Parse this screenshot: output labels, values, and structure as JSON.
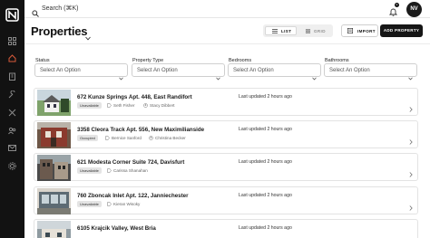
{
  "search": {
    "placeholder": "Search (⌘K)"
  },
  "topbar": {
    "notification_count": "0",
    "avatar_initials": "NV"
  },
  "header": {
    "title": "Properties",
    "view_toggle": {
      "list_label": "LIST",
      "grid_label": "GRID",
      "selected": "LIST"
    },
    "import_label": "IMPORT",
    "add_label": "ADD PROPERTY"
  },
  "filters": [
    {
      "label": "Status",
      "placeholder": "Select An Option"
    },
    {
      "label": "Property Type",
      "placeholder": "Select An Option"
    },
    {
      "label": "Bedrooms",
      "placeholder": "Select An Option"
    },
    {
      "label": "Bathrooms",
      "placeholder": "Select An Option"
    }
  ],
  "properties": [
    {
      "address": "672 Kunze Springs Apt. 448, East Randifort",
      "status": "Unavailable",
      "agent": "Seth Fisher",
      "owner": "Stacy Dibbert",
      "updated": "Last updated 2 hours ago"
    },
    {
      "address": "3358 Cleora Track Apt. 556, New Maximilianside",
      "status": "Occupied",
      "agent": "Bernice Sanford",
      "owner": "Christina Becker",
      "updated": "Last updated 2 hours ago"
    },
    {
      "address": "621 Modesta Corner Suite 724, Davisfurt",
      "status": "Unavailable",
      "agent": "Carissa Shanahan",
      "owner": "",
      "updated": "Last updated 2 hours ago"
    },
    {
      "address": "760 Zboncak Inlet Apt. 122, Janniechester",
      "status": "Unavailable",
      "agent": "Kieran Wisoky",
      "owner": "",
      "updated": "Last updated 2 hours ago"
    },
    {
      "address": "6105 Krajcik Valley, West Bria",
      "status": "",
      "agent": "",
      "owner": "",
      "updated": "Last updated 2 hours ago"
    }
  ],
  "icons": {
    "logo": "logo-icon",
    "sidebar": [
      "grid-icon",
      "home-icon",
      "building-icon",
      "wrench-icon",
      "tools-icon",
      "people-icon",
      "mail-icon",
      "settings-icon"
    ],
    "search": "search-icon",
    "bell": "bell-icon",
    "row_agent": "tag-icon",
    "row_owner": "person-icon",
    "row_arrow": "chevron-right-icon"
  },
  "colors": {
    "sidebar": "#121212",
    "primary_button": "#161616",
    "active_nav": "#d85a3a"
  }
}
